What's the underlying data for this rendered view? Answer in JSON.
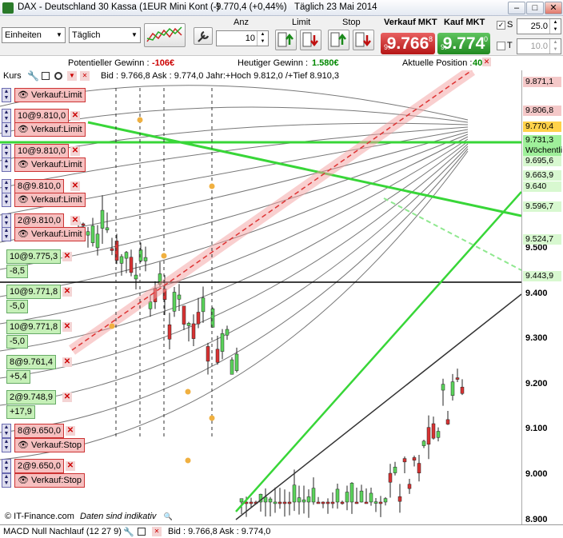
{
  "window": {
    "title": "DAX - Deutschland 30 Kassa  (1EUR Mini Kont (-)",
    "last": "9.770,4 (+0,44%)",
    "period": "Täglich  23 Mai 2014",
    "btn_min": "–",
    "btn_max": "□",
    "btn_close": "✕"
  },
  "toolbar": {
    "units_value": "Einheiten",
    "period_value": "Täglich",
    "anz_label": "Anz",
    "anz_value": "10",
    "limit_label": "Limit",
    "stop_label": "Stop",
    "sell_label": "Verkauf MKT",
    "buy_label": "Kauf MKT",
    "sell_big": "9.766",
    "sell_small_pre": "9.",
    "sell_small_post": "8",
    "buy_big": "9.774",
    "buy_small_pre": "9.",
    "buy_small_post": "0",
    "s_label": "S",
    "s_value": "25.0",
    "t_label": "T",
    "t_value": "10.0"
  },
  "info": {
    "pot_label": "Potentieller Gewinn :",
    "pot_value": "-106€",
    "today_label": "Heutiger Gewinn :",
    "today_value": "1.580€",
    "pos_label": "Aktuelle Position :",
    "pos_value": "40"
  },
  "legend": {
    "name": "Kurs",
    "text": "Bid : 9.766,8 Ask : 9.774,0 Jahr:+Hoch 9.812,0 /+Tief 8.910,3"
  },
  "orders": [
    {
      "label": "Verkauf:Limit",
      "kind": "btn"
    },
    {
      "label": "10@9.810,0",
      "kind": "qty"
    },
    {
      "label": "Verkauf:Limit",
      "kind": "btn"
    },
    {
      "label": "10@9.810,0",
      "kind": "qty"
    },
    {
      "label": "Verkauf:Limit",
      "kind": "btn"
    },
    {
      "label": "8@9.810,0",
      "kind": "qty"
    },
    {
      "label": "Verkauf:Limit",
      "kind": "btn"
    },
    {
      "label": "2@9.810,0",
      "kind": "qty"
    },
    {
      "label": "Verkauf:Limit",
      "kind": "btn"
    }
  ],
  "positions": [
    {
      "label": "10@9.775,3",
      "pl": "-8,5"
    },
    {
      "label": "10@9.771,8",
      "pl": "-5,0"
    },
    {
      "label": "10@9.771,8",
      "pl": "-5,0"
    },
    {
      "label": "8@9.761,4",
      "pl": "+5,4"
    },
    {
      "label": "2@9.748,9",
      "pl": "+17,9"
    }
  ],
  "stops": [
    {
      "label": "8@9.650,0",
      "btn": "Verkauf:Stop"
    },
    {
      "label": "2@9.650,0",
      "btn": "Verkauf:Stop"
    }
  ],
  "yaxis": {
    "ticks": [
      "9.500",
      "9.400",
      "9.300",
      "9.200",
      "9.100",
      "9.000",
      "8.900"
    ],
    "tags": [
      {
        "text": "9.871,1",
        "color": "#f4c8c8"
      },
      {
        "text": "9.806,8",
        "color": "#f4c8c8"
      },
      {
        "text": "9.770,4",
        "color": "#ffd24a"
      },
      {
        "text": "9.731,3",
        "color": "#9ff09a"
      },
      {
        "text": "Wöchentli",
        "color": "#9ff09a"
      },
      {
        "text": "9.695,6",
        "color": "#d8f8d0"
      },
      {
        "text": "9.663,9",
        "color": "#d8f8d0"
      },
      {
        "text": "9.640",
        "color": "#d8f8d0"
      },
      {
        "text": "9.596,7",
        "color": "#d8f8d0"
      },
      {
        "text": "9.524,7",
        "color": "#d8f8d0"
      },
      {
        "text": "9.443,9",
        "color": "#d8f8d0"
      }
    ]
  },
  "footer": {
    "source": "© IT-Finance.com",
    "note": "Daten sind indikativ"
  },
  "macd": {
    "name": "MACD Null Nachlauf (12 27 9)",
    "text": "Bid : 9.766,8 Ask : 9.774,0"
  }
}
